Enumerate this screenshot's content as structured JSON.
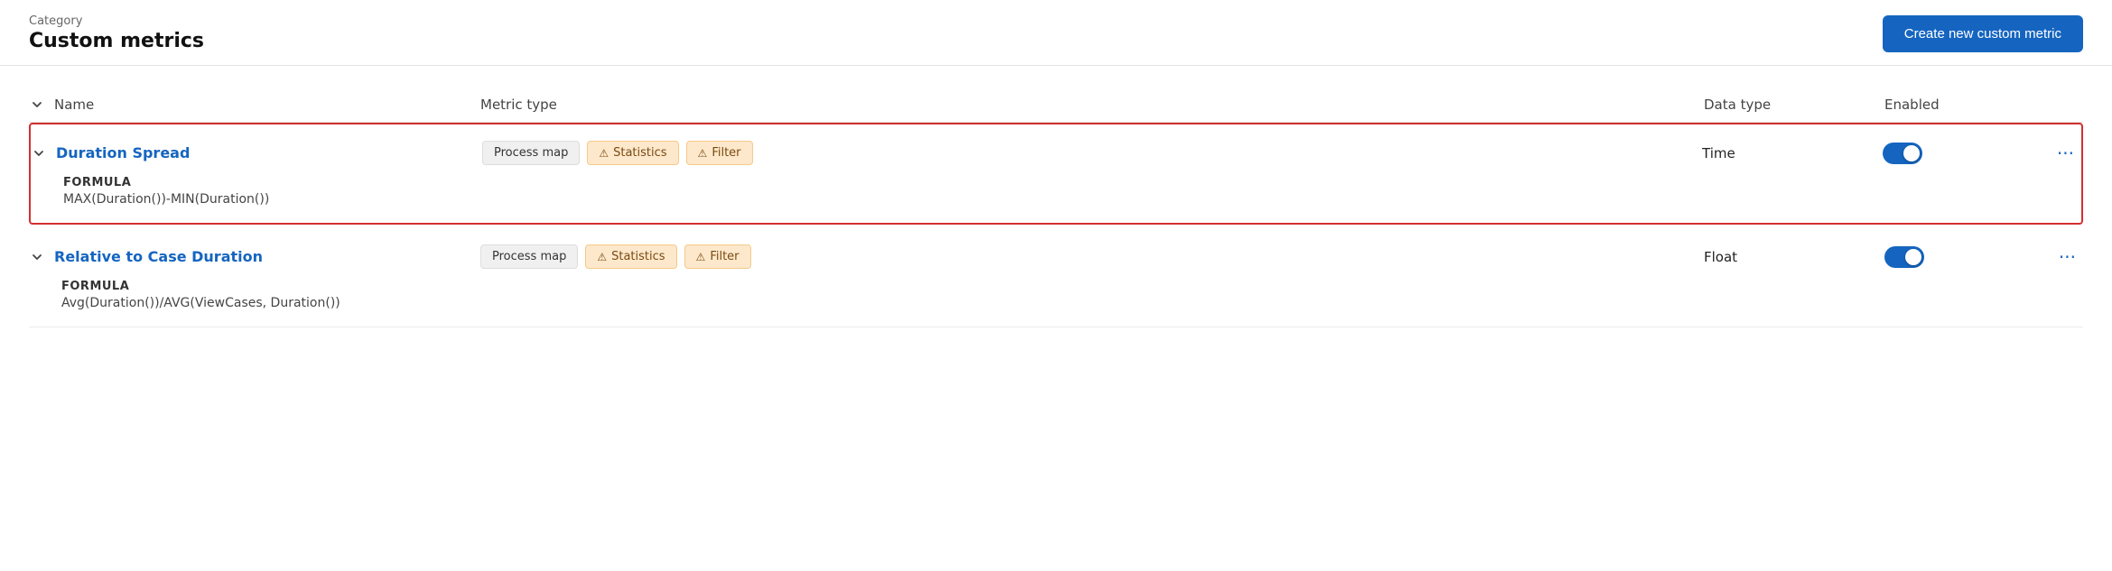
{
  "header": {
    "category_label": "Category",
    "page_title": "Custom metrics",
    "create_button_label": "Create new custom metric"
  },
  "table": {
    "columns": [
      "Name",
      "Metric type",
      "Data type",
      "Enabled",
      ""
    ],
    "rows": [
      {
        "id": "duration-spread",
        "name": "Duration Spread",
        "highlighted": true,
        "expanded": true,
        "formula_label": "FORMULA",
        "formula_value": "MAX(Duration())-MIN(Duration())",
        "metric_types": [
          {
            "label": "Process map",
            "style": "gray"
          },
          {
            "label": "Statistics",
            "style": "warning"
          },
          {
            "label": "Filter",
            "style": "warning"
          }
        ],
        "data_type": "Time",
        "enabled": true
      },
      {
        "id": "relative-to-case-duration",
        "name": "Relative to Case Duration",
        "highlighted": false,
        "expanded": true,
        "formula_label": "FORMULA",
        "formula_value": "Avg(Duration())/AVG(ViewCases, Duration())",
        "metric_types": [
          {
            "label": "Process map",
            "style": "gray"
          },
          {
            "label": "Statistics",
            "style": "warning"
          },
          {
            "label": "Filter",
            "style": "warning"
          }
        ],
        "data_type": "Float",
        "enabled": true
      }
    ]
  }
}
